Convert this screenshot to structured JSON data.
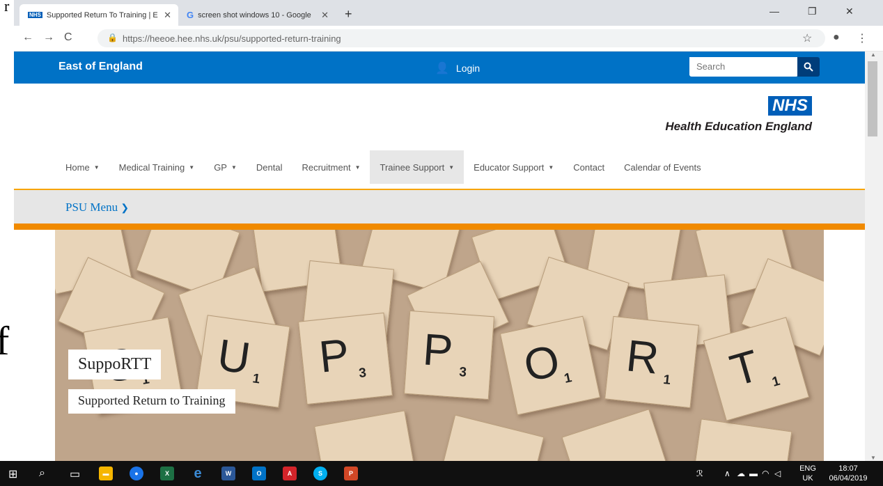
{
  "browser": {
    "tabs": [
      {
        "title": "Supported Return To Training | E",
        "favicon": "nhs-icon"
      },
      {
        "title": "screen shot windows 10 - Google",
        "favicon": "google-icon"
      }
    ],
    "url_host": "https://heeoe.hee.nhs.uk",
    "url_path": "/psu/supported-return-training"
  },
  "site": {
    "brand": "East of England",
    "login_label": "Login",
    "search_placeholder": "Search",
    "logo_nhs": "NHS",
    "logo_text": "Health Education England",
    "nav": [
      {
        "label": "Home",
        "dropdown": true
      },
      {
        "label": "Medical Training",
        "dropdown": true
      },
      {
        "label": "GP",
        "dropdown": true
      },
      {
        "label": "Dental",
        "dropdown": false
      },
      {
        "label": "Recruitment",
        "dropdown": true
      },
      {
        "label": "Trainee Support",
        "dropdown": true,
        "active": true
      },
      {
        "label": "Educator Support",
        "dropdown": true
      },
      {
        "label": "Contact",
        "dropdown": false
      },
      {
        "label": "Calendar of Events",
        "dropdown": false
      }
    ],
    "psu_menu": "PSU Menu"
  },
  "hero": {
    "tiles": [
      {
        "letter": "S",
        "sub": "1"
      },
      {
        "letter": "U",
        "sub": "1"
      },
      {
        "letter": "P",
        "sub": "3"
      },
      {
        "letter": "P",
        "sub": "3"
      },
      {
        "letter": "O",
        "sub": "1"
      },
      {
        "letter": "R",
        "sub": "1"
      },
      {
        "letter": "T",
        "sub": "1"
      }
    ],
    "title": "SuppoRTT",
    "subtitle": "Supported Return to Training"
  },
  "taskbar": {
    "language_top": "ENG",
    "language_bottom": "UK",
    "time": "18:07",
    "date": "06/04/2019"
  },
  "colors": {
    "site_blue": "#0072c6",
    "nhs_blue": "#005eb8",
    "orange": "#f08a00"
  }
}
